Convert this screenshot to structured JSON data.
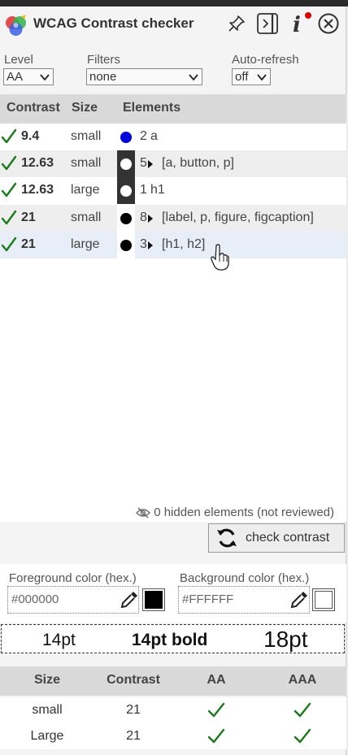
{
  "header": {
    "title": "WCAG Contrast checker",
    "icons": [
      "logo-icon",
      "pin-icon",
      "dock-icon",
      "info-icon",
      "close-icon"
    ],
    "info_badge_color": "#e00000"
  },
  "controls": {
    "level_label": "Level",
    "level_value": "AA",
    "filters_label": "Filters",
    "filters_value": "none",
    "autorefresh_label": "Auto-refresh",
    "autorefresh_value": "off"
  },
  "table": {
    "columns": [
      "Contrast",
      "Size",
      "Elements"
    ],
    "rows": [
      {
        "contrast": "9.4",
        "size": "small",
        "count": "2",
        "elements": "a",
        "expandable": false,
        "dot_color": "#0000dd",
        "swatch_bg": "#ffffff"
      },
      {
        "contrast": "12.63",
        "size": "small",
        "count": "5",
        "elements": "[a, button, p]",
        "expandable": true,
        "dot_color": "#ffffff",
        "swatch_bg": "#333333"
      },
      {
        "contrast": "12.63",
        "size": "large",
        "count": "1",
        "elements": "h1",
        "expandable": false,
        "dot_color": "#ffffff",
        "swatch_bg": "#333333"
      },
      {
        "contrast": "21",
        "size": "small",
        "count": "8",
        "elements": "[label, p, figure, figcaption]",
        "expandable": true,
        "dot_color": "#000000",
        "swatch_bg": "#ffffff"
      },
      {
        "contrast": "21",
        "size": "large",
        "count": "3",
        "elements": "[h1, h2]",
        "expandable": true,
        "dot_color": "#000000",
        "swatch_bg": "#ffffff"
      }
    ]
  },
  "hidden_note": "0 hidden elements (not reviewed)",
  "check_button": "check contrast",
  "colors": {
    "fg_label": "Foreground color (hex.)",
    "fg_value": "#000000",
    "bg_label": "Background color (hex.)",
    "bg_value": "#FFFFFF"
  },
  "samples": {
    "s1": "14pt",
    "s2": "14pt bold",
    "s3": "18pt"
  },
  "results": {
    "columns": [
      "Size",
      "Contrast",
      "AA",
      "AAA"
    ],
    "rows": [
      {
        "size": "small",
        "contrast": "21",
        "aa": "pass",
        "aaa": "pass"
      },
      {
        "size": "Large",
        "contrast": "21",
        "aa": "pass",
        "aaa": "pass"
      }
    ]
  },
  "theme": {
    "check_color": "#1a7a1a",
    "highlight_row": "#e8eef8"
  }
}
